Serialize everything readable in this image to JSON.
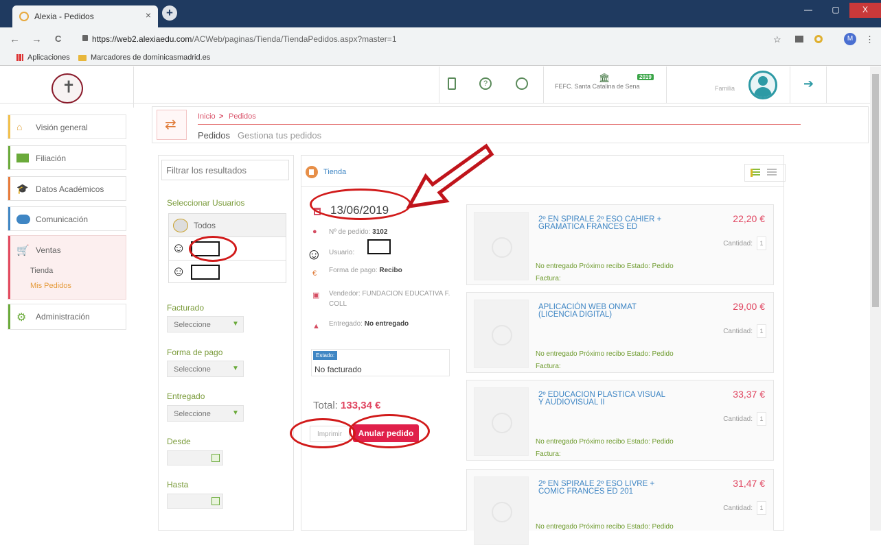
{
  "browser": {
    "tab_title": "Alexia - Pedidos",
    "tab_close": "×",
    "new_tab": "+",
    "url_host": "https://web2.alexiaedu.com",
    "url_path": "/ACWeb/paginas/Tienda/TiendaPedidos.aspx?master=1",
    "back": "←",
    "forward": "→",
    "reload": "C",
    "star": "☆",
    "ext_menu": "⋮",
    "profile_initial": "M",
    "bookmarks": [
      "Aplicaciones",
      "Marcadores de dominicasmadrid.es"
    ],
    "window_buttons": [
      "—",
      "▢",
      "X"
    ]
  },
  "header": {
    "school_name": "FEFC. Santa Catalina de Sena",
    "year_badge": "2019",
    "user_role": "Familia",
    "icons": [
      "tablet-icon",
      "help-icon",
      "history-icon",
      "bank-icon",
      "logout-icon"
    ]
  },
  "sidebar": {
    "items": [
      {
        "label": "Visión general",
        "icon": "home-icon"
      },
      {
        "label": "Filiación",
        "icon": "id-card-icon"
      },
      {
        "label": "Datos Académicos",
        "icon": "graduation-cap-icon"
      },
      {
        "label": "Comunicación",
        "icon": "chat-icon"
      },
      {
        "label": "Ventas",
        "icon": "cart-icon",
        "sub": [
          "Tienda",
          "Mis Pedidos"
        ]
      },
      {
        "label": "Administración",
        "icon": "gears-icon"
      }
    ]
  },
  "breadcrumb": {
    "home": "Inicio",
    "separator": ">",
    "current": "Pedidos",
    "title": "Pedidos",
    "subtitle": "Gestiona tus pedidos"
  },
  "filters": {
    "search_placeholder": "Filtrar los resultados",
    "users_label": "Seleccionar Usuarios",
    "all_users": "Todos",
    "facturado_label": "Facturado",
    "forma_pago_label": "Forma de pago",
    "entregado_label": "Entregado",
    "desde_label": "Desde",
    "hasta_label": "Hasta",
    "select_value": "Seleccione"
  },
  "main": {
    "tab_label": "Tienda",
    "order": {
      "date": "13/06/2019",
      "pedido_label": "Nº de pedido:",
      "pedido_num": "3102",
      "usuario_label": "Usuario:",
      "forma_pago_label": "Forma de pago:",
      "forma_pago_val": "Recibo",
      "vendedor_l1": "Vendedor: FUNDACION EDUCATIVA F.",
      "vendedor_l2": "COLL",
      "entregado_label": "Entregado:",
      "entregado_val": "No entregado",
      "estado_chip": "Estado:",
      "estado_val": "No facturado",
      "total_label": "Total:",
      "total_val": "133,34 €",
      "print_btn": "Imprimir",
      "cancel_btn": "Anular pedido"
    },
    "products": [
      {
        "name_l1": "2º EN SPIRALE 2º ESO CAHIER +",
        "name_l2": "GRAMATICA FRANCES ED",
        "price": "22,20 €",
        "qty": "1"
      },
      {
        "name_l1": "APLICACIÓN WEB ONMAT",
        "name_l2": "(LICENCIA DIGITAL)",
        "price": "29,00 €",
        "qty": "1"
      },
      {
        "name_l1": "2º EDUCACION PLASTICA VISUAL",
        "name_l2": "Y AUDIOVISUAL II",
        "price": "33,37 €",
        "qty": "1"
      },
      {
        "name_l1": "2º EN SPIRALE 2º ESO LIVRE +",
        "name_l2": "COMIC FRANCES ED 201",
        "price": "31,47 €",
        "qty": "1"
      }
    ],
    "cantidad_label": "Cantidad:",
    "status_line": "No entregado   Próximo recibo   Estado: Pedido",
    "factura_label": "Factura:"
  },
  "annotations": {
    "color": "#d11a1a"
  }
}
